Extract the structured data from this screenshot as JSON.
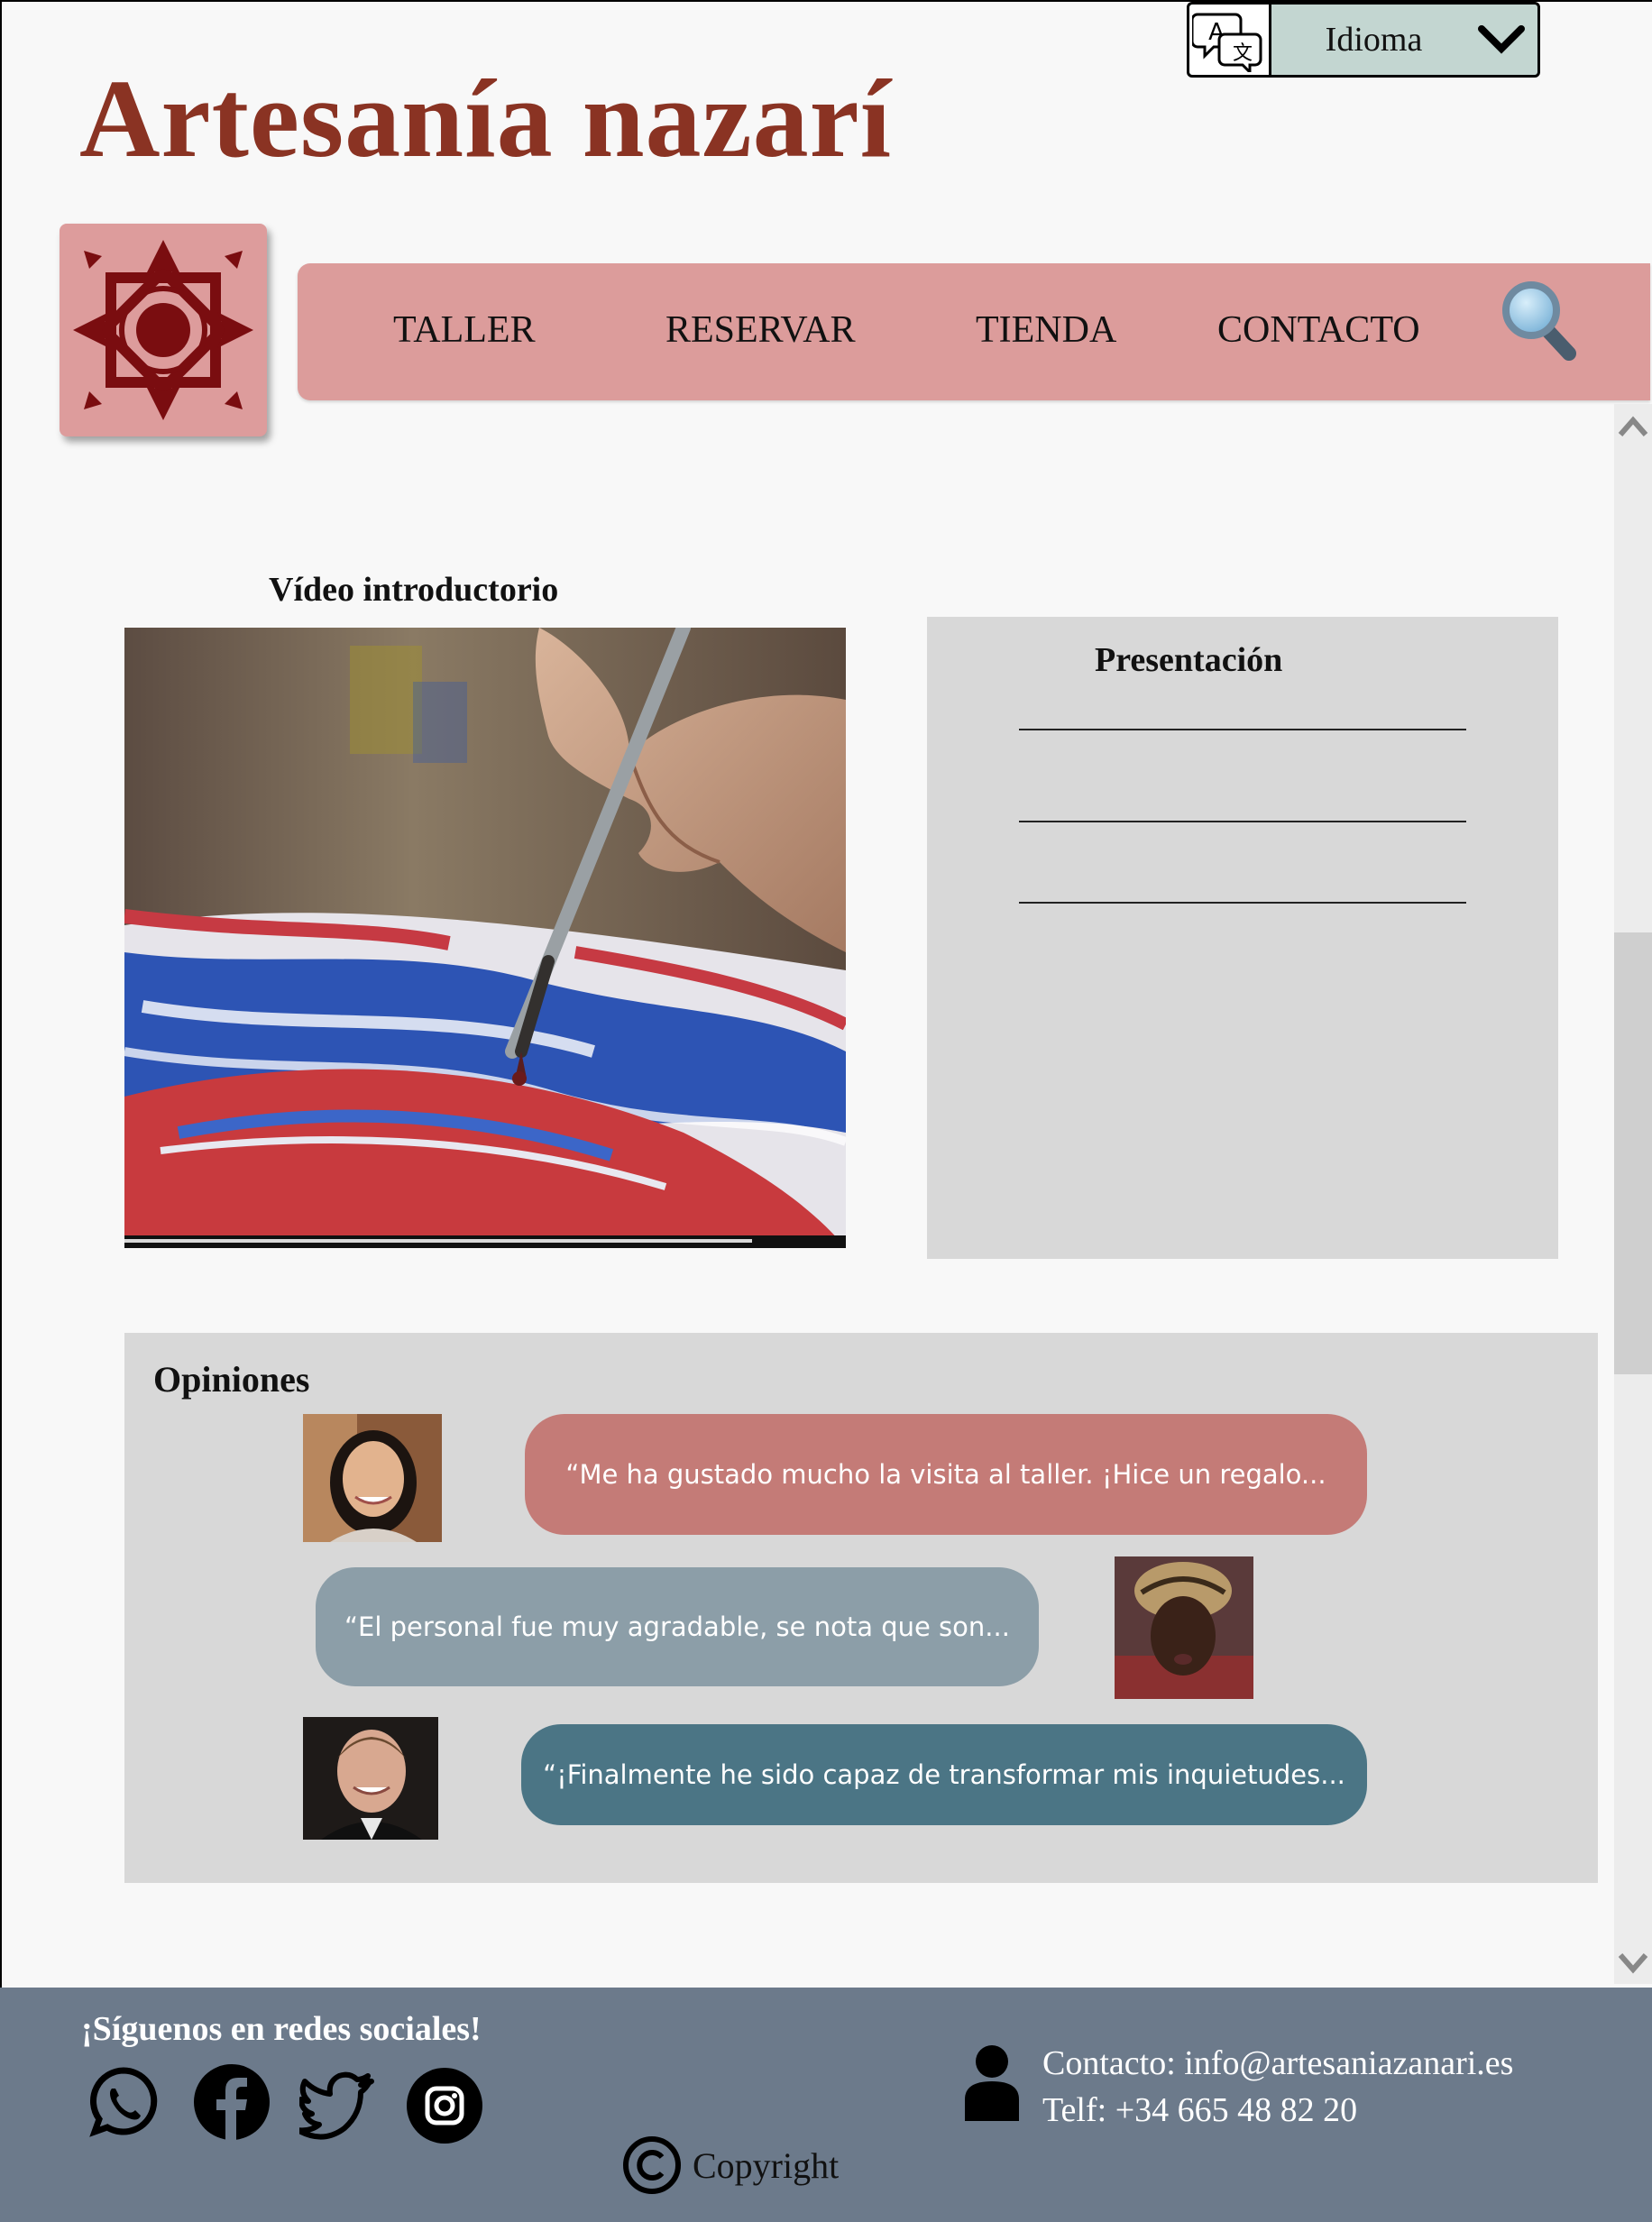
{
  "header": {
    "title": "Artesanía nazarí",
    "language": {
      "label": "Idioma",
      "icon": "translate-icon",
      "chevron": "chevron-down-icon"
    }
  },
  "nav": {
    "items": [
      "TALLER",
      "RESERVAR",
      "TIENDA",
      "CONTACTO"
    ],
    "search_icon": "search-icon"
  },
  "video": {
    "title": "Vídeo introductorio",
    "progress": 0.87
  },
  "presentation": {
    "title": "Presentación"
  },
  "opinions": {
    "title": "Opiniones",
    "items": [
      {
        "text": "“Me ha gustado mucho la visita al taller. ¡Hice un regalo...",
        "color": "#c47b77"
      },
      {
        "text": "“El personal fue muy agradable, se nota que son...",
        "color": "#8c9ea8"
      },
      {
        "text": "“¡Finalmente he sido capaz de transformar mis inquietudes...",
        "color": "#4b7585"
      }
    ]
  },
  "footer": {
    "social_title": "¡Síguenos en redes sociales!",
    "social_icons": [
      "whatsapp-icon",
      "facebook-icon",
      "twitter-icon",
      "instagram-icon"
    ],
    "contact_line1": "Contacto: info@artesaniazanari.es",
    "contact_line2": "Telf: +34 665 48 82 20",
    "copyright": "Copyright"
  },
  "colors": {
    "title": "#8a3323",
    "nav_bg": "#dc9c9b",
    "tile_pattern": "#7a0d10",
    "panel_bg": "#d8d8d8",
    "footer_bg": "#6c7a8b",
    "language_bg": "#c3d6d1"
  }
}
